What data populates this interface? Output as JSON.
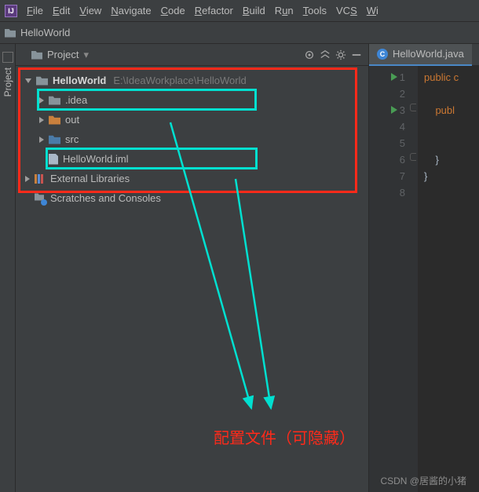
{
  "menu": {
    "items": [
      "File",
      "Edit",
      "View",
      "Navigate",
      "Code",
      "Refactor",
      "Build",
      "Run",
      "Tools",
      "VCS",
      "Wi"
    ]
  },
  "breadcrumb": {
    "project": "HelloWorld"
  },
  "project_panel": {
    "title": "Project",
    "root": {
      "name": "HelloWorld",
      "path": "E:\\IdeaWorkplace\\HelloWorld"
    },
    "children": {
      "idea": ".idea",
      "out": "out",
      "src": "src",
      "iml": "HelloWorld.iml"
    },
    "external": "External Libraries",
    "scratch": "Scratches and Consoles"
  },
  "editor": {
    "tab": "HelloWorld.java",
    "lines": {
      "l1": "public c",
      "l3": "    publ",
      "l6": "    }",
      "l7": "}"
    },
    "line_numbers": [
      "1",
      "2",
      "3",
      "4",
      "5",
      "6",
      "7",
      "8"
    ]
  },
  "annotation": "配置文件（可隐藏）",
  "watermark": "CSDN @居酱的小猪"
}
